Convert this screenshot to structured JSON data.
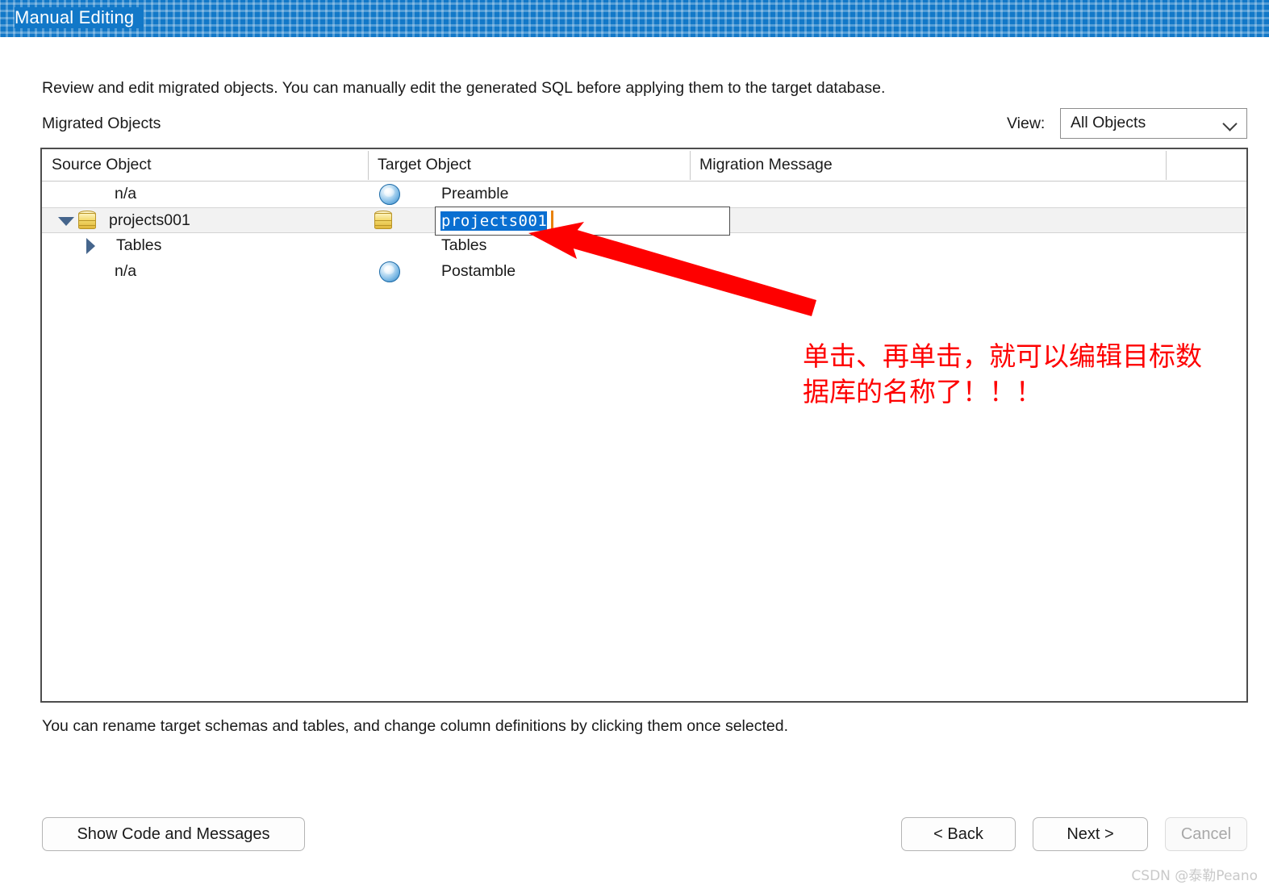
{
  "window": {
    "title": "Manual Editing",
    "titlebar_color": "#1278c8"
  },
  "intro": {
    "description": "Review and edit migrated objects. You can manually edit the generated SQL before applying them to the target database.",
    "section_label": "Migrated Objects"
  },
  "view_filter": {
    "label": "View:",
    "selected": "All Objects",
    "options": [
      "All Objects"
    ]
  },
  "grid": {
    "columns": [
      "Source Object",
      "Target Object",
      "Migration Message"
    ],
    "rows": [
      {
        "source": "n/a",
        "target": "Preamble",
        "target_icon": "sphere-icon",
        "message": "",
        "indent": 1,
        "twisty": "none",
        "source_icon": "none",
        "selected": false,
        "editing": false
      },
      {
        "source": "projects001",
        "target": "projects001",
        "target_icon": "database-icon",
        "message": "",
        "indent": 0,
        "twisty": "down",
        "source_icon": "database-icon",
        "selected": true,
        "editing": true
      },
      {
        "source": "Tables",
        "target": "Tables",
        "target_icon": "none",
        "message": "",
        "indent": 1,
        "twisty": "right",
        "source_icon": "none",
        "selected": false,
        "editing": false
      },
      {
        "source": "n/a",
        "target": "Postamble",
        "target_icon": "sphere-icon",
        "message": "",
        "indent": 1,
        "twisty": "none",
        "source_icon": "none",
        "selected": false,
        "editing": false
      }
    ]
  },
  "edit_field": {
    "value": "projects001",
    "selected": true,
    "selection_color": "#0a6fd1",
    "caret_color": "#e8820c"
  },
  "annotation": {
    "text_line1": "单击、再单击，就可以编辑目标数",
    "text_line2": "据库的名称了！！！",
    "color": "#fe0000"
  },
  "hint": "You can rename target schemas and tables, and change column definitions by clicking them once selected.",
  "buttons": {
    "show_code": "Show Code and Messages",
    "back": "< Back",
    "next": "Next >",
    "cancel": "Cancel"
  },
  "watermark": "CSDN @泰勒Peano"
}
